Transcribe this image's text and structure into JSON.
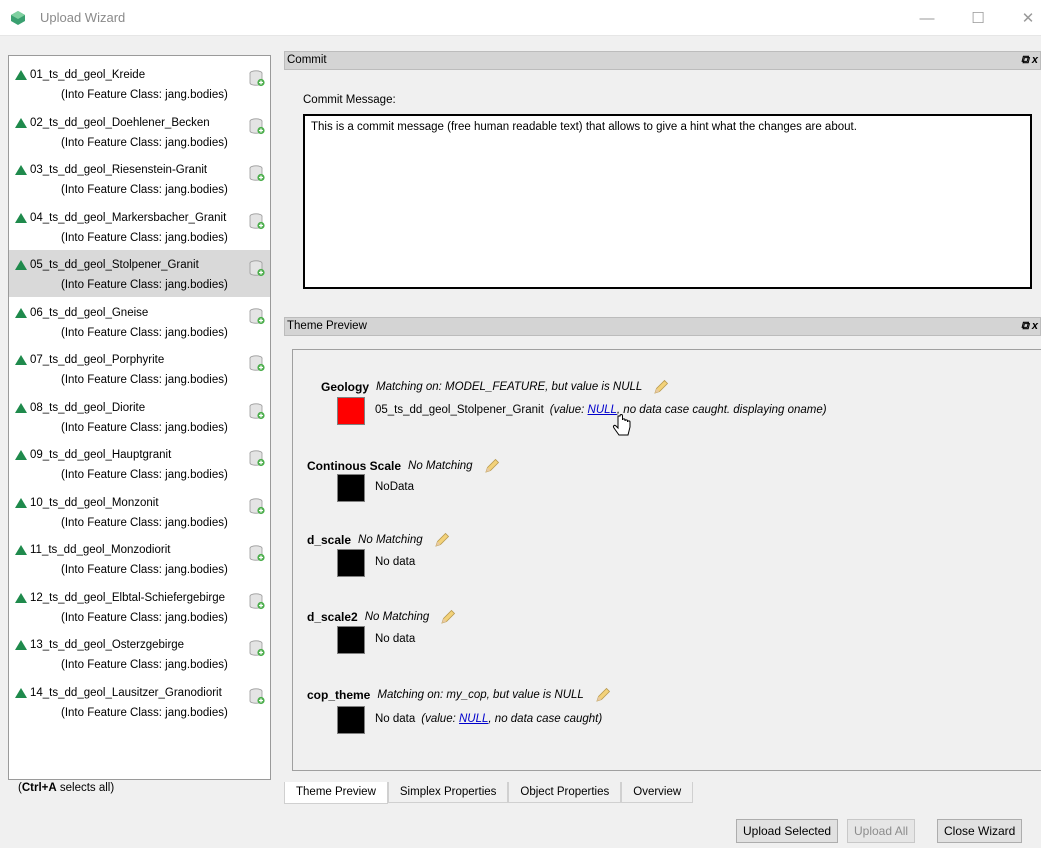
{
  "window": {
    "title": "Upload Wizard",
    "minimize_icon": "—",
    "maximize_icon": "☐",
    "close_icon": "✕"
  },
  "items": [
    {
      "name": "01_ts_dd_geol_Kreide",
      "sub": "(Into Feature Class: jang.bodies)"
    },
    {
      "name": "02_ts_dd_geol_Doehlener_Becken",
      "sub": "(Into Feature Class: jang.bodies)"
    },
    {
      "name": "03_ts_dd_geol_Riesenstein-Granit",
      "sub": "(Into Feature Class: jang.bodies)"
    },
    {
      "name": "04_ts_dd_geol_Markersbacher_Granit",
      "sub": "(Into Feature Class: jang.bodies)"
    },
    {
      "name": "05_ts_dd_geol_Stolpener_Granit",
      "sub": "(Into Feature Class: jang.bodies)"
    },
    {
      "name": "06_ts_dd_geol_Gneise",
      "sub": "(Into Feature Class: jang.bodies)"
    },
    {
      "name": "07_ts_dd_geol_Porphyrite",
      "sub": "(Into Feature Class: jang.bodies)"
    },
    {
      "name": "08_ts_dd_geol_Diorite",
      "sub": "(Into Feature Class: jang.bodies)"
    },
    {
      "name": "09_ts_dd_geol_Hauptgranit",
      "sub": "(Into Feature Class: jang.bodies)"
    },
    {
      "name": "10_ts_dd_geol_Monzonit",
      "sub": "(Into Feature Class: jang.bodies)"
    },
    {
      "name": "11_ts_dd_geol_Monzodiorit",
      "sub": "(Into Feature Class: jang.bodies)"
    },
    {
      "name": "12_ts_dd_geol_Elbtal-Schiefergebirge",
      "sub": "(Into Feature Class: jang.bodies)"
    },
    {
      "name": "13_ts_dd_geol_Osterzgebirge",
      "sub": "(Into Feature Class: jang.bodies)"
    },
    {
      "name": "14_ts_dd_geol_Lausitzer_Granodiorit",
      "sub": "(Into Feature Class: jang.bodies)"
    }
  ],
  "selected_index": 4,
  "shortcut_hint": {
    "key": "Ctrl+A",
    "text": " selects all)",
    "open": "("
  },
  "commit": {
    "panel_title": "Commit",
    "label": "Commit Message:",
    "message": "This is a commit message (free human readable text) that allows to give a hint what the changes are about."
  },
  "theme_preview": {
    "panel_title": "Theme Preview",
    "themes": [
      {
        "name": "Geology",
        "matching": "Matching on: MODEL_FEATURE, but value is NULL",
        "swatch_color": "#ff0000",
        "label": "05_ts_dd_geol_Stolpener_Granit",
        "value_prefix": "(value: ",
        "value_link": "NULL",
        "value_suffix": ", no data case caught. displaying oname)"
      },
      {
        "name": "Continous Scale",
        "matching": "No Matching",
        "swatch_color": "#000000",
        "label": "NoData",
        "value_prefix": "",
        "value_link": "",
        "value_suffix": ""
      },
      {
        "name": "d_scale",
        "matching": "No Matching",
        "swatch_color": "#000000",
        "label": "No data",
        "value_prefix": "",
        "value_link": "",
        "value_suffix": ""
      },
      {
        "name": "d_scale2",
        "matching": "No Matching",
        "swatch_color": "#000000",
        "label": "No data",
        "value_prefix": "",
        "value_link": "",
        "value_suffix": ""
      },
      {
        "name": "cop_theme",
        "matching": "Matching on: my_cop, but value is NULL",
        "swatch_color": "#000000",
        "label": "No data",
        "value_prefix": "(value: ",
        "value_link": "NULL",
        "value_suffix": ", no data case caught)"
      }
    ]
  },
  "tabs": [
    "Theme Preview",
    "Simplex Properties",
    "Object Properties",
    "Overview"
  ],
  "active_tab": 0,
  "buttons": {
    "upload_selected": "Upload Selected",
    "upload_all": "Upload All",
    "close_wizard": "Close Wizard"
  },
  "colors": {
    "triangle": "#1f8a4c",
    "selected_row": "#d9d9d9",
    "link": "#0000cc"
  }
}
